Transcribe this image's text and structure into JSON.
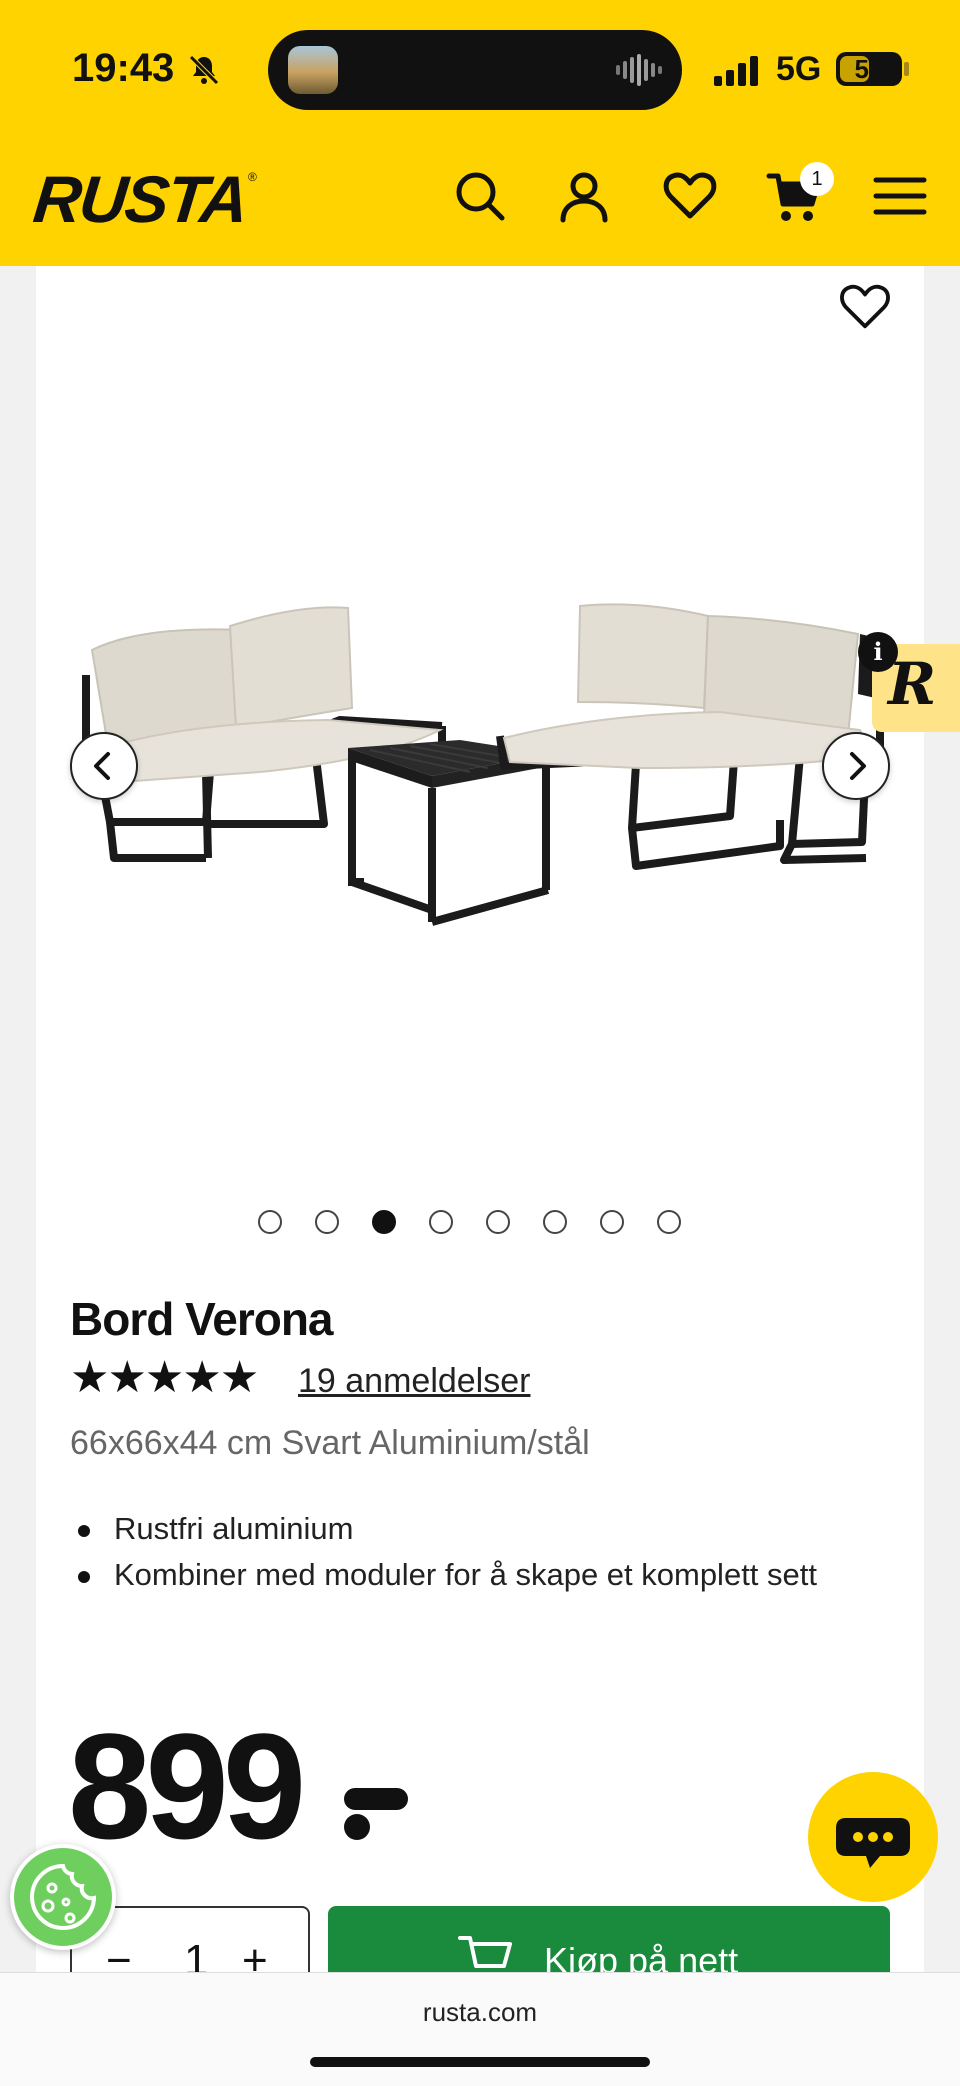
{
  "status_bar": {
    "time": "19:43",
    "network": "5G",
    "battery_level": "50",
    "battery_fraction": 0.5
  },
  "header": {
    "logo": "RUSTA",
    "logo_mark": "®",
    "cart_count": "1",
    "icons": [
      "search-icon",
      "account-icon",
      "heart-icon",
      "cart-icon",
      "menu-icon"
    ]
  },
  "gallery": {
    "image_count": 8,
    "active_index": 2,
    "info_badge": "i",
    "info_tab_letter": "R"
  },
  "product": {
    "title": "Bord Verona",
    "rating": 5,
    "reviews": "19 anmeldelser",
    "subtitle": "66x66x44 cm Svart Aluminium/stål",
    "bullets": [
      "Rustfri aluminium",
      "Kombiner med moduler for å skape et komplett sett"
    ],
    "price": "899"
  },
  "purchase": {
    "qty_minus": "−",
    "qty_value": "1",
    "qty_plus": "+",
    "buy_label": "Kjøp på nett"
  },
  "browser": {
    "url": "rusta.com"
  },
  "colors": {
    "brand_yellow": "#FFD300",
    "buy_green": "#1a8a3c",
    "cookie_green": "#6fcf5e"
  }
}
